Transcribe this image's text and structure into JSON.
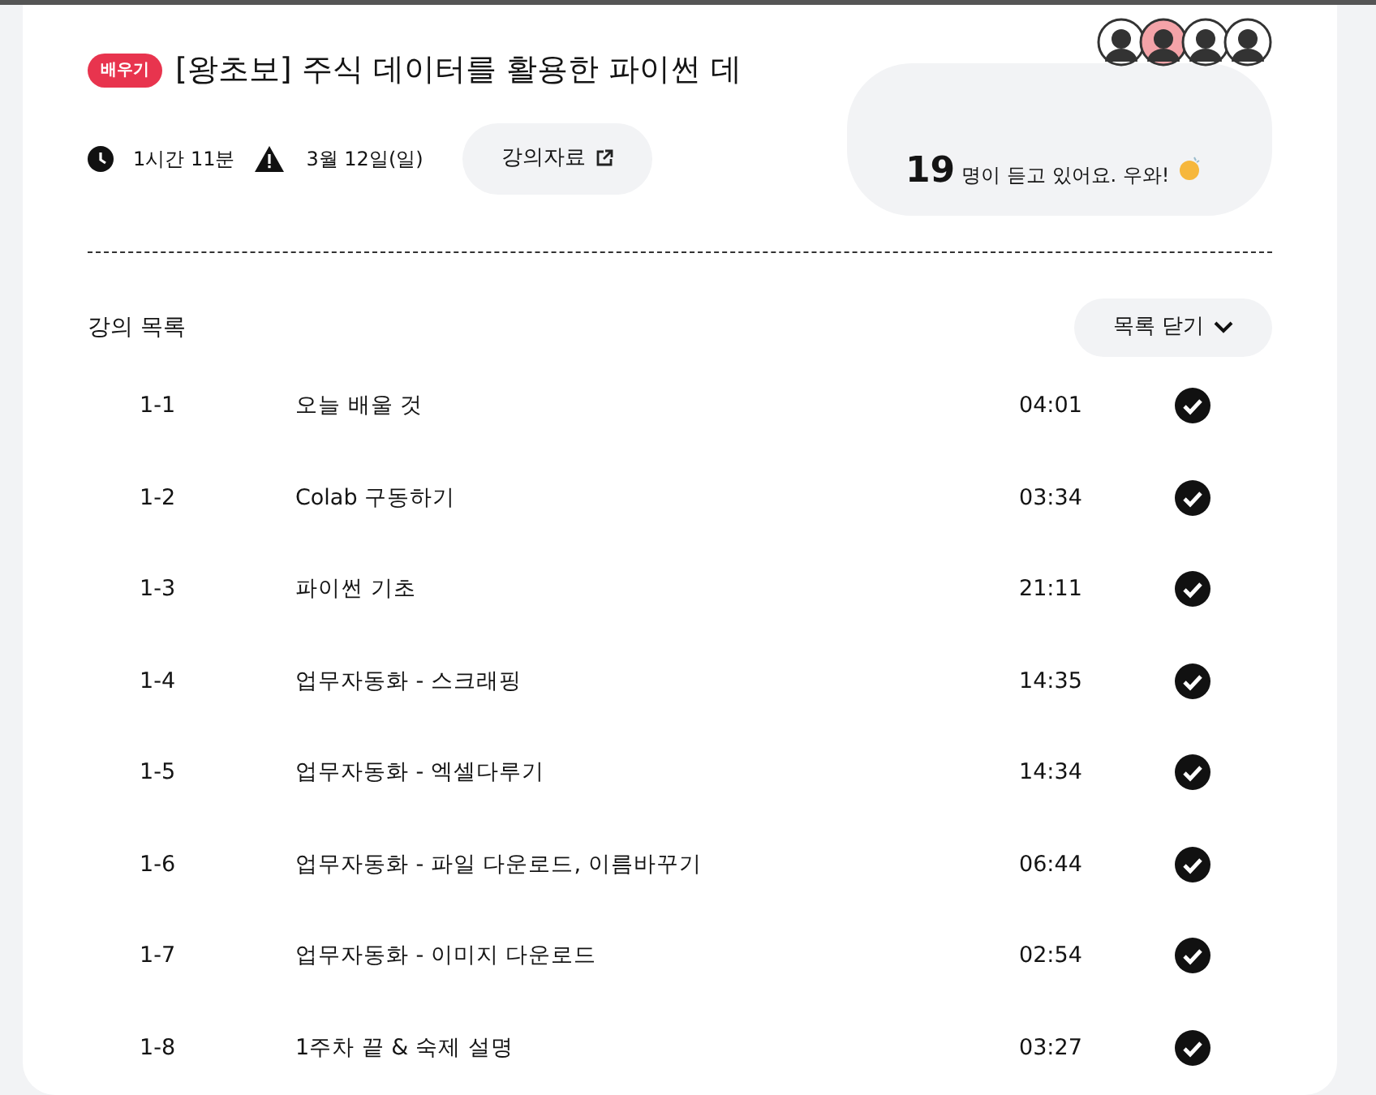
{
  "header": {
    "badge": "배우기",
    "title": "[왕초보] 주식 데이터를 활용한 파이썬 데",
    "duration": "1시간 11분",
    "date": "3월 12일(일)",
    "materials_button": "강의자료"
  },
  "listeners": {
    "count": "19",
    "message": "명이 듣고 있어요. 우와!"
  },
  "lessons_section": {
    "title": "강의 목록",
    "toggle_button": "목록 닫기"
  },
  "lessons": [
    {
      "number": "1-1",
      "title": "오늘 배울 것",
      "time": "04:01",
      "done": true
    },
    {
      "number": "1-2",
      "title": "Colab 구동하기",
      "time": "03:34",
      "done": true
    },
    {
      "number": "1-3",
      "title": "파이썬 기초",
      "time": "21:11",
      "done": true
    },
    {
      "number": "1-4",
      "title": "업무자동화 - 스크래핑",
      "time": "14:35",
      "done": true
    },
    {
      "number": "1-5",
      "title": "업무자동화 - 엑셀다루기",
      "time": "14:34",
      "done": true
    },
    {
      "number": "1-6",
      "title": "업무자동화 - 파일 다운로드, 이름바꾸기",
      "time": "06:44",
      "done": true
    },
    {
      "number": "1-7",
      "title": "업무자동화 - 이미지 다운로드",
      "time": "02:54",
      "done": true
    },
    {
      "number": "1-8",
      "title": "1주차 끝 & 숙제 설명",
      "time": "03:27",
      "done": true
    }
  ]
}
